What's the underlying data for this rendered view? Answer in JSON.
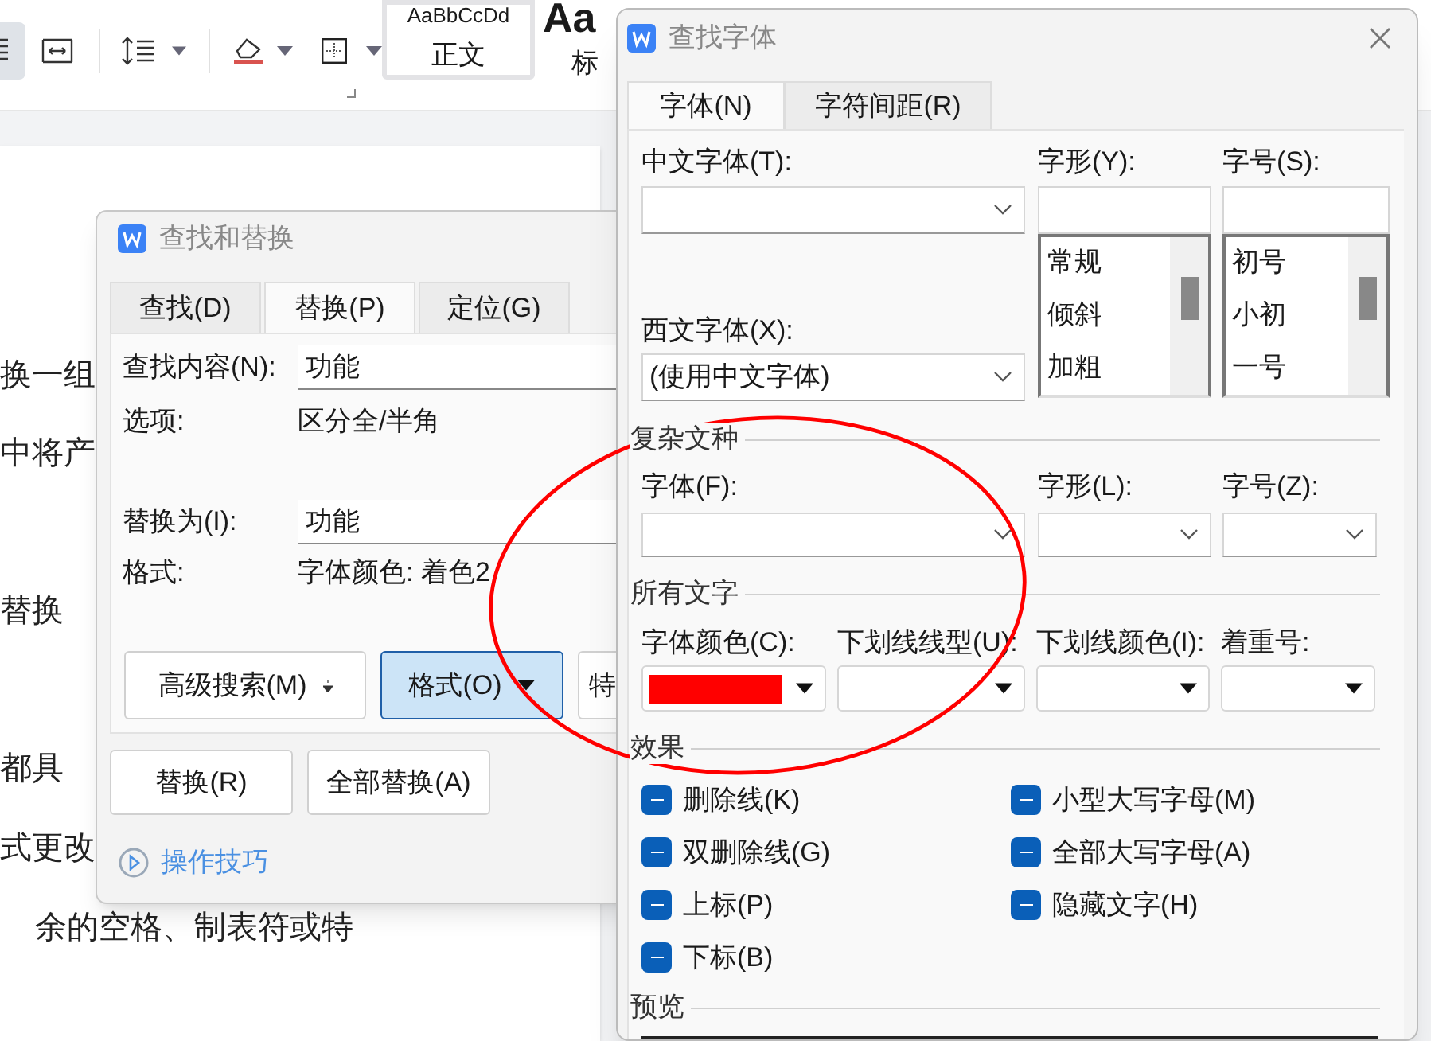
{
  "ribbon": {
    "styles": [
      {
        "preview": "AaBbCcDd",
        "name": "正文",
        "selected": true
      },
      {
        "preview": "Aa",
        "name": "标",
        "selected": false
      }
    ]
  },
  "document": {
    "lines": [
      "换一组",
      "中将产",
      "替换",
      "都具",
      "式更改",
      "余的空格、制表符或特"
    ]
  },
  "find_replace": {
    "title": "查找和替换",
    "tabs": [
      {
        "label": "查找(D)",
        "selected": false
      },
      {
        "label": "替换(P)",
        "selected": true
      },
      {
        "label": "定位(G)",
        "selected": false
      }
    ],
    "rows": [
      {
        "kind": "field",
        "label": "查找内容(N):",
        "value": "功能"
      },
      {
        "kind": "info",
        "label": "选项:",
        "value": "区分全/半角"
      },
      {
        "kind": "field",
        "label": "替换为(I):",
        "value": "功能"
      },
      {
        "kind": "info",
        "label": "格式:",
        "value": "字体颜色: 着色2"
      }
    ],
    "buttons": [
      {
        "label": "高级搜索(M)",
        "kind": "menu",
        "selected": false
      },
      {
        "label": "格式(O)",
        "kind": "split",
        "selected": true
      },
      {
        "label": "特",
        "kind": "plain",
        "selected": false
      }
    ],
    "actions": [
      "替换(R)",
      "全部替换(A)"
    ],
    "tips_link": "操作技巧"
  },
  "font_dialog": {
    "title": "查找字体",
    "tabs": [
      {
        "label": "字体(N)",
        "selected": true
      },
      {
        "label": "字符间距(R)",
        "selected": false
      }
    ],
    "chinese_font": {
      "label": "中文字体(T):"
    },
    "western_font": {
      "label": "西文字体(X):",
      "value": "(使用中文字体)"
    },
    "style": {
      "label": "字形(Y):",
      "items": [
        "常规",
        "倾斜",
        "加粗"
      ]
    },
    "size": {
      "label": "字号(S):",
      "items": [
        "初号",
        "小初",
        "一号"
      ]
    },
    "complex_script": {
      "title": "复杂文种",
      "fields": [
        {
          "label": "字体(F):"
        },
        {
          "label": "字形(L):"
        },
        {
          "label": "字号(Z):"
        }
      ]
    },
    "all_text": {
      "title": "所有文字",
      "fields": [
        {
          "label": "字体颜色(C):",
          "color": "#ff0000"
        },
        {
          "label": "下划线线型(U):"
        },
        {
          "label": "下划线颜色(I):"
        },
        {
          "label": "着重号:"
        }
      ]
    },
    "effects": {
      "title": "效果",
      "items": [
        {
          "label": "删除线(K)",
          "mixed": true
        },
        {
          "label": "小型大写字母(M)",
          "mixed": true
        },
        {
          "label": "双删除线(G)",
          "mixed": true
        },
        {
          "label": "全部大写字母(A)",
          "mixed": true
        },
        {
          "label": "上标(P)",
          "mixed": true
        },
        {
          "label": "隐藏文字(H)",
          "mixed": true
        },
        {
          "label": "下标(B)",
          "mixed": true
        }
      ]
    },
    "preview": {
      "title": "预览"
    }
  },
  "annotation": {
    "kind": "ellipse",
    "color": "#ff0000"
  }
}
